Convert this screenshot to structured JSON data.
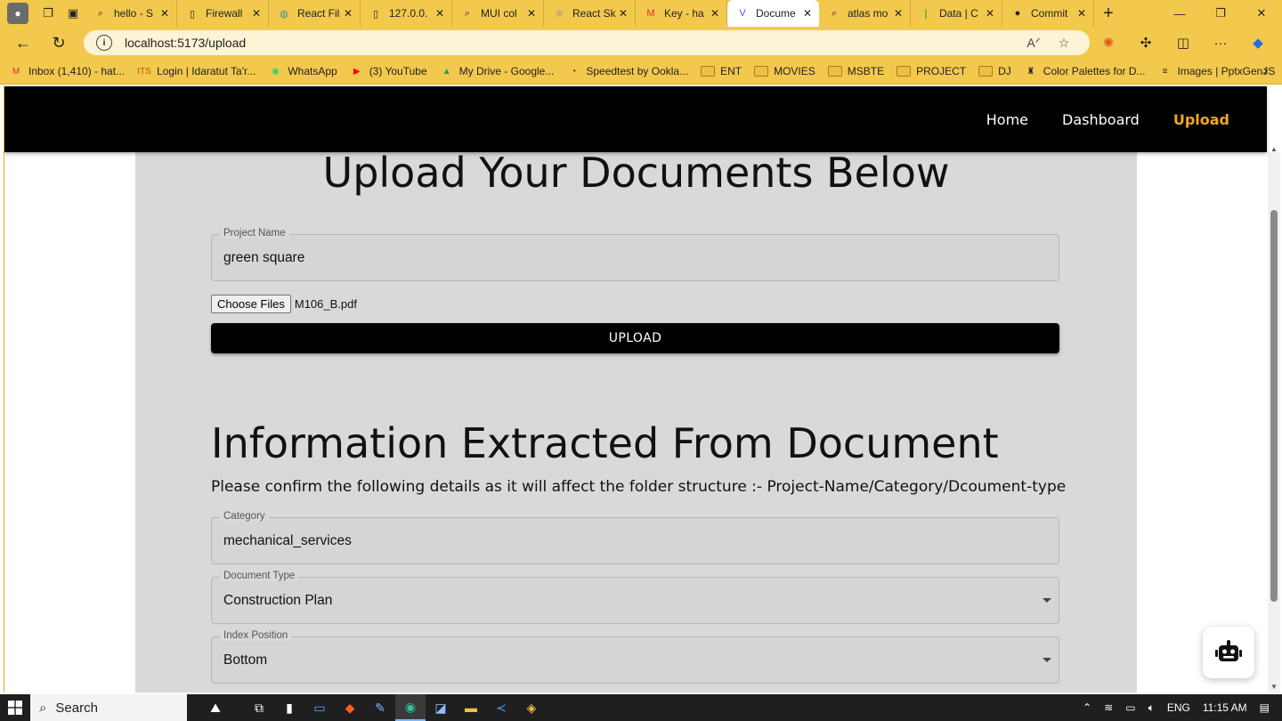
{
  "browser": {
    "tabs": [
      {
        "label": "hello - S",
        "icon": "search-icon"
      },
      {
        "label": "Firewall",
        "icon": "document-icon"
      },
      {
        "label": "React Fil",
        "icon": "globe-icon"
      },
      {
        "label": "127.0.0.",
        "icon": "document-icon"
      },
      {
        "label": "MUI col",
        "icon": "search-icon"
      },
      {
        "label": "React Sk",
        "icon": "react-icon"
      },
      {
        "label": "Key - ha",
        "icon": "gmail-icon"
      },
      {
        "label": "Docume",
        "icon": "vite-icon",
        "active": true
      },
      {
        "label": "atlas mo",
        "icon": "search-icon"
      },
      {
        "label": "Data | C",
        "icon": "mongodb-icon"
      },
      {
        "label": "Commit",
        "icon": "github-icon"
      }
    ],
    "url": "localhost:5173/upload",
    "bookmarks": [
      {
        "label": "Inbox (1,410) - hat...",
        "icon": "gmail-icon"
      },
      {
        "label": "Login | Idaratut Ta'r...",
        "icon": "its-icon"
      },
      {
        "label": "WhatsApp",
        "icon": "whatsapp-icon"
      },
      {
        "label": "(3) YouTube",
        "icon": "youtube-icon"
      },
      {
        "label": "My Drive - Google...",
        "icon": "drive-icon"
      },
      {
        "label": "Speedtest by Ookla...",
        "icon": "speedtest-icon"
      },
      {
        "label": "ENT",
        "icon": "folder-icon"
      },
      {
        "label": "MOVIES",
        "icon": "folder-icon"
      },
      {
        "label": "MSBTE",
        "icon": "folder-icon"
      },
      {
        "label": "PROJECT",
        "icon": "folder-icon"
      },
      {
        "label": "DJ",
        "icon": "folder-icon"
      },
      {
        "label": "Color Palettes for D...",
        "icon": "palette-icon"
      },
      {
        "label": "Images | PptxGenJS",
        "icon": "images-icon"
      }
    ],
    "colors": {
      "chrome": "#f3c94d",
      "omnibox": "#fdf3d6"
    }
  },
  "app": {
    "nav": {
      "home": "Home",
      "dashboard": "Dashboard",
      "upload": "Upload"
    },
    "accent": "#f0a81e",
    "heading": "Upload Your Documents Below",
    "project_field": {
      "label": "Project Name",
      "value": "green square"
    },
    "file_picker": {
      "button": "Choose Files",
      "filename": "M106_B.pdf"
    },
    "upload_button": "UPLOAD",
    "extract_heading": "Information Extracted From Document",
    "confirm_text": "Please confirm the following details as it will affect the folder structure :- Project-Name/Category/Dcoument-type",
    "category_field": {
      "label": "Category",
      "value": "mechanical_services"
    },
    "doctype_field": {
      "label": "Document Type",
      "value": "Construction Plan"
    },
    "index_field": {
      "label": "Index Position",
      "value": "Bottom"
    }
  },
  "taskbar": {
    "search_label": "Search",
    "language": "ENG",
    "time": "11:15 AM"
  }
}
